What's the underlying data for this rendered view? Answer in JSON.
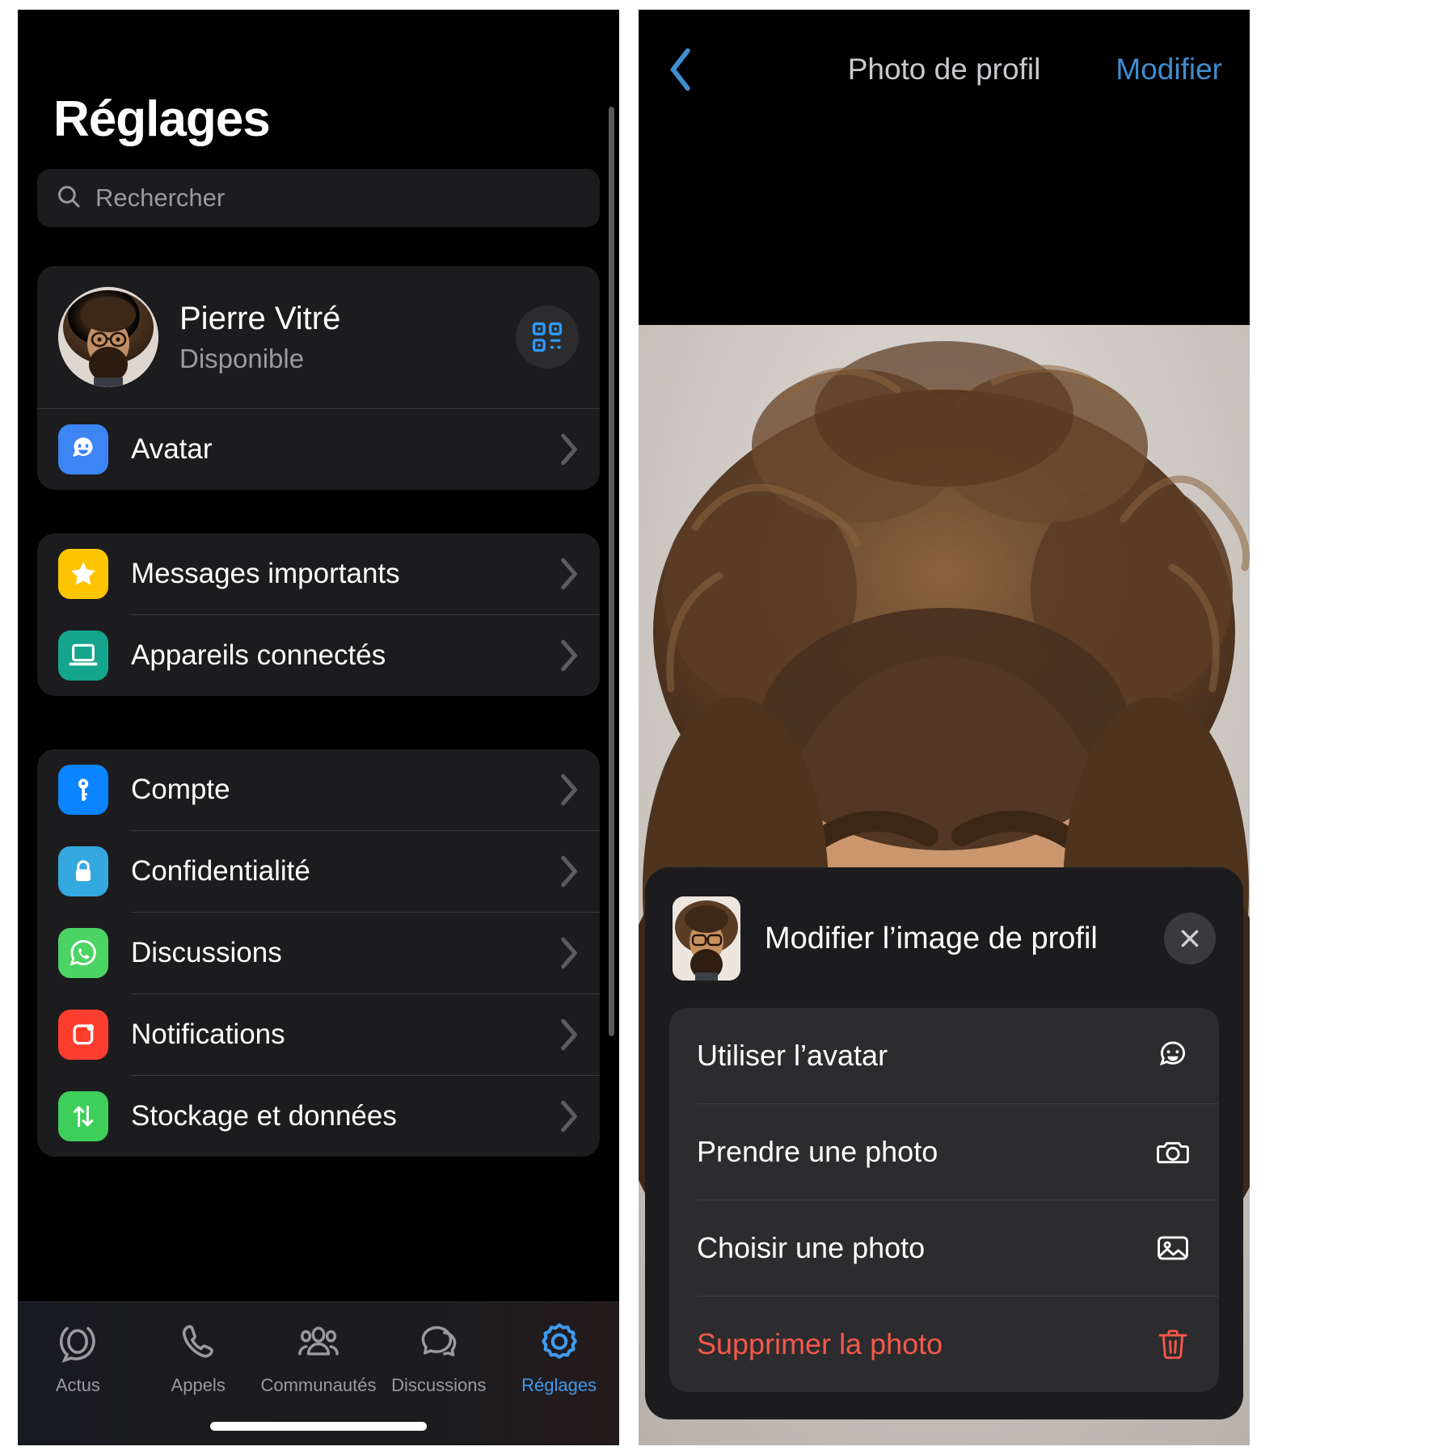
{
  "left_phone": {
    "page_title": "Réglages",
    "search": {
      "placeholder": "Rechercher",
      "icon": "search-icon"
    },
    "profile": {
      "name": "Pierre Vitré",
      "status": "Disponible",
      "avatar_icon": "user-avatar-photo",
      "qr_icon": "qr-code-icon"
    },
    "avatar_row": {
      "label": "Avatar",
      "icon": "avatar-face-icon",
      "chevron": "chevron-right-icon"
    },
    "group_two": [
      {
        "label": "Messages importants",
        "icon": "star-icon",
        "icon_color": "#ffc400",
        "chevron": "chevron-right-icon"
      },
      {
        "label": "Appareils connectés",
        "icon": "laptop-icon",
        "icon_color": "#14a58c",
        "chevron": "chevron-right-icon"
      }
    ],
    "group_three": [
      {
        "label": "Compte",
        "icon": "key-icon",
        "icon_color": "#0a84ff",
        "chevron": "chevron-right-icon"
      },
      {
        "label": "Confidentialité",
        "icon": "lock-icon",
        "icon_color": "#35a8e0",
        "chevron": "chevron-right-icon"
      },
      {
        "label": "Discussions",
        "icon": "whatsapp-icon",
        "icon_color": "#4bd364",
        "chevron": "chevron-right-icon"
      },
      {
        "label": "Notifications",
        "icon": "notification-icon",
        "icon_color": "#fc3d2e",
        "chevron": "chevron-right-icon"
      },
      {
        "label": "Stockage et données",
        "icon": "storage-arrows-icon",
        "icon_color": "#3ecf5b",
        "chevron": "chevron-right-icon"
      }
    ],
    "tabs": [
      {
        "label": "Actus",
        "icon": "status-ring-icon",
        "active": false
      },
      {
        "label": "Appels",
        "icon": "phone-icon",
        "active": false
      },
      {
        "label": "Communautés",
        "icon": "communities-people-icon",
        "active": false
      },
      {
        "label": "Discussions",
        "icon": "chat-bubbles-icon",
        "active": false
      },
      {
        "label": "Réglages",
        "icon": "gear-icon",
        "active": true
      }
    ]
  },
  "right_phone": {
    "nav": {
      "back_icon": "chevron-left-icon",
      "title": "Photo de profil",
      "action_label": "Modifier"
    },
    "photo": {
      "alt": "profile-photo"
    },
    "sheet": {
      "thumb_icon": "profile-thumbnail",
      "title": "Modifier l’image de profil",
      "close_icon": "close-icon",
      "items": [
        {
          "label": "Utiliser l’avatar",
          "icon": "avatar-face-icon",
          "danger": false
        },
        {
          "label": "Prendre une photo",
          "icon": "camera-icon",
          "danger": false
        },
        {
          "label": "Choisir une photo",
          "icon": "photo-library-icon",
          "danger": false
        },
        {
          "label": "Supprimer la photo",
          "icon": "trash-icon",
          "danger": true
        }
      ]
    }
  },
  "colors": {
    "accent_blue": "#3e8ed0",
    "tab_active_blue": "#3e9bf0",
    "danger_red": "#f5584a",
    "card_bg": "#1c1c1e",
    "sheet_list_bg": "#2c2c2e",
    "page_bg": "#000000"
  }
}
